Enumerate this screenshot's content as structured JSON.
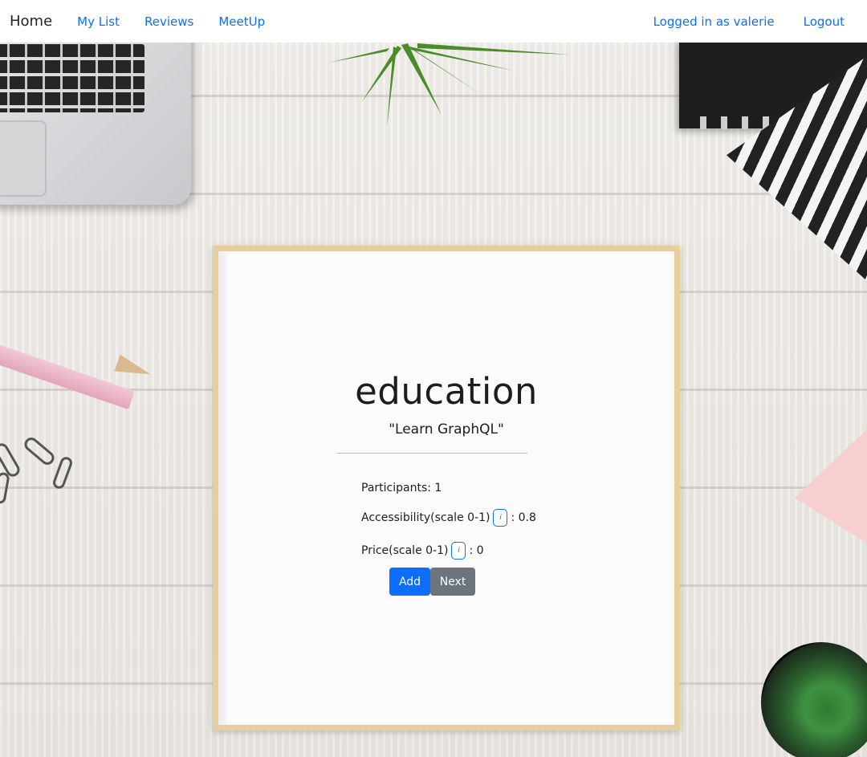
{
  "navbar": {
    "brand": "Home",
    "links": [
      "My List",
      "Reviews",
      "MeetUp"
    ],
    "user_status": "Logged in as valerie",
    "logout": "Logout"
  },
  "card": {
    "category": "education",
    "activity": "\"Learn GraphQL\"",
    "participants": "Participants: 1",
    "accessibility_label": "Accessibility(scale 0-1)",
    "accessibility_value": ": 0.8",
    "price_label": "Price(scale 0-1)",
    "price_value": ": 0",
    "info_icon": "i",
    "add_label": "Add",
    "next_label": "Next"
  },
  "colors": {
    "link": "#0d6efd",
    "primary_button": "#0d6efd",
    "secondary_button": "#6c757d",
    "frame": "#e7cf9d"
  },
  "icons": {
    "info": "info-icon"
  }
}
